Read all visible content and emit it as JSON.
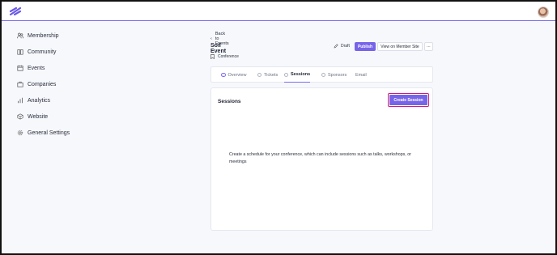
{
  "sidebar": {
    "items": [
      {
        "label": "Membership",
        "icon": "users-icon"
      },
      {
        "label": "Community",
        "icon": "book-icon"
      },
      {
        "label": "Events",
        "icon": "calendar-icon"
      },
      {
        "label": "Companies",
        "icon": "briefcase-icon"
      },
      {
        "label": "Analytics",
        "icon": "bar-chart-icon"
      },
      {
        "label": "Website",
        "icon": "cube-icon"
      },
      {
        "label": "General Settings",
        "icon": "gear-icon"
      }
    ]
  },
  "header": {
    "back_label": "Back to Events",
    "event_title": "Soil Event",
    "event_type": "Conference",
    "draft_label": "Draft",
    "publish_label": "Publish",
    "view_site_label": "View on Member Site",
    "more_label": "⋯"
  },
  "tabs": [
    {
      "label": "Overview",
      "state": "done"
    },
    {
      "label": "Tickets",
      "state": "todo"
    },
    {
      "label": "Sessions",
      "state": "active"
    },
    {
      "label": "Sponsors",
      "state": "todo"
    },
    {
      "label": "Email",
      "state": "none"
    }
  ],
  "sessions_card": {
    "title": "Sessions",
    "create_label": "Create Session",
    "empty_text": "Create a schedule for your conference, which can include sessions such as talks, workshops, or meetings"
  },
  "colors": {
    "accent": "#7864e8",
    "highlight_border": "#d4187a",
    "background": "#f6f8fc"
  }
}
